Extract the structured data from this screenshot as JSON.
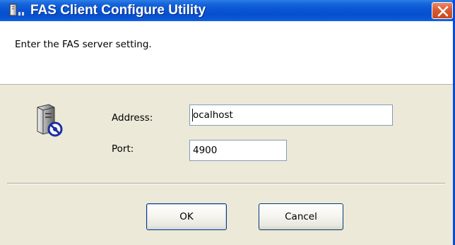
{
  "window": {
    "title": "FAS Client Configure Utility"
  },
  "header": {
    "prompt": "Enter the FAS server setting."
  },
  "form": {
    "address_label": "Address:",
    "address_value": "ocalhost",
    "port_label": "Port:",
    "port_value": "4900"
  },
  "buttons": {
    "ok_label": "OK",
    "cancel_label": "Cancel"
  },
  "icons": {
    "app": "server-app-icon",
    "main": "server-settings-icon",
    "close": "close-icon"
  },
  "colors": {
    "titlebar": "#0a55d4",
    "close": "#d85b32",
    "dialog_bg": "#ece9d8",
    "field_border": "#7f9db9"
  }
}
